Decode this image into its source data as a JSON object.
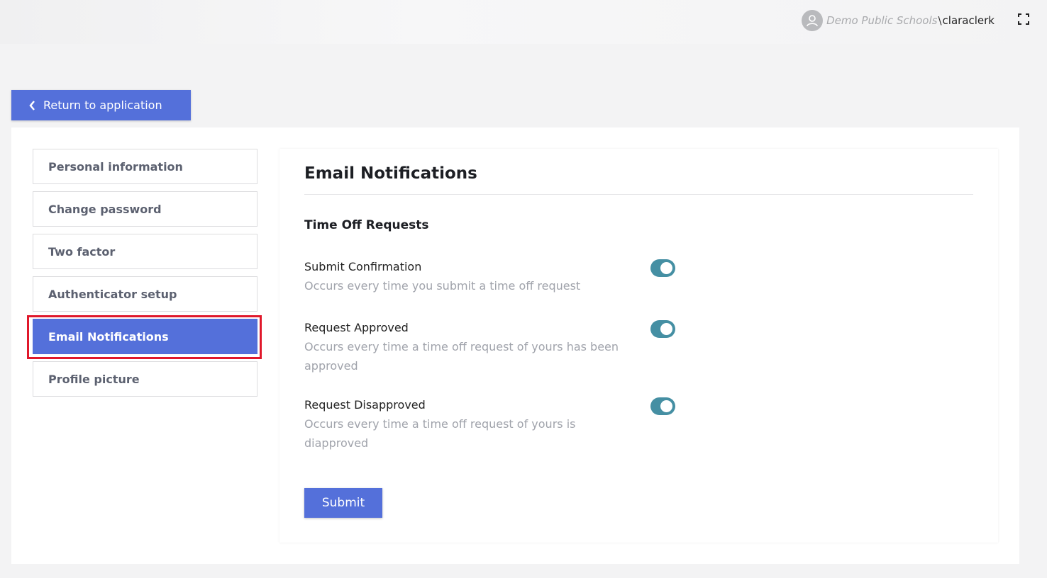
{
  "header": {
    "org_name": "Demo Public Schools",
    "separator": "\\",
    "username": "claraclerk",
    "avatar_icon": "user-avatar-icon",
    "fullscreen_icon": "fullscreen-icon"
  },
  "return_button": {
    "label": "Return to application",
    "icon": "chevron-left-icon"
  },
  "sidebar": {
    "items": [
      {
        "label": "Personal information",
        "active": false
      },
      {
        "label": "Change password",
        "active": false
      },
      {
        "label": "Two factor",
        "active": false
      },
      {
        "label": "Authenticator setup",
        "active": false
      },
      {
        "label": "Email Notifications",
        "active": true
      },
      {
        "label": "Profile picture",
        "active": false
      }
    ]
  },
  "content": {
    "title": "Email Notifications",
    "section_title": "Time Off Requests",
    "notifications": [
      {
        "title": "Submit Confirmation",
        "description": "Occurs every time you submit a time off request",
        "enabled": true
      },
      {
        "title": "Request Approved",
        "description": "Occurs every time a time off request of yours has been approved",
        "enabled": true
      },
      {
        "title": "Request Disapproved",
        "description": "Occurs every time a time off request of yours is diapproved",
        "enabled": true
      }
    ],
    "submit_label": "Submit"
  },
  "colors": {
    "accent": "#5470da",
    "toggle_on": "#458fa3",
    "highlight": "#e0182b"
  }
}
